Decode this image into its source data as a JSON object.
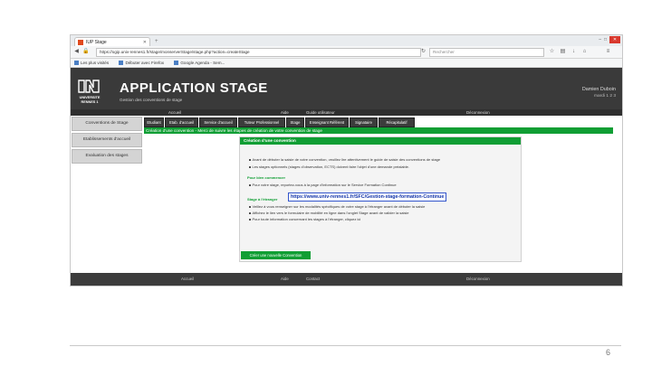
{
  "browser": {
    "tab_title": "IUP Stage",
    "new_tab": "+",
    "url": "https://ogip.univ-rennes1.fr/stage/monserverStage/stage.php?action=createStage",
    "search_placeholder": "Rechercher",
    "bookmarks": [
      "Les plus visités",
      "Débuter avec Firefox",
      "Google Agenda - Sem..."
    ]
  },
  "app": {
    "title": "APPLICATION STAGE",
    "subtitle": "Gestion des conventions de stage",
    "logo_text": "UNIVERSITE RENNES 1",
    "user_name": "Damien Duboin",
    "user_date": "mardi 1 2 3",
    "menu": [
      "Accueil",
      "Aide",
      "Guide utilisateur",
      "Déconnexion"
    ]
  },
  "sidebar": {
    "items": [
      "Conventions de Stage",
      "Etablissements d'accueil",
      "Evaluation des stages"
    ]
  },
  "tabs": [
    "Etudiant",
    "Etab. d'accueil",
    "Service d'accueil",
    "Tuteur Professionnel",
    "Stage",
    "Enseignant Référent",
    "Signataire",
    "Récapitulatif"
  ],
  "green_bar": "Création d'une convention - Merci de suivre les étapes de création de votre convention de stage",
  "panel": {
    "title": "Création d'une convention",
    "lines": [
      "Avant de débuter la saisie de votre convention, veuillez lire attentivement le guide de saisie des conventions de stage",
      "Les stages optionnels (stages d'observation, ECTS) doivent faire l'objet d'une demande préalable."
    ],
    "section1": "Pour bien commencer",
    "section1_lines": [
      "Pour votre stage, reportez-vous à la page d'information sur le Service Formation Continue"
    ],
    "link": "https://www.univ-rennes1.fr/SFC/Gestion-stage-formation-Continue",
    "section2": "Stage à l'étranger",
    "section2_lines": [
      "Veillez à vous renseigner sur les modalités spécifiques de votre stage à l'étranger avant de débuter la saisie",
      "Affichez le lien vers le formulaire de mobilité en ligne dans l'onglet Stage avant de valider la saisie",
      "Pour toute information concernant les stages à l'étranger, cliquez ici"
    ],
    "create_button": "Créer une nouvelle Convention"
  },
  "footer": {
    "items": [
      "Accueil",
      "Aide",
      "Contact",
      "Déconnexion"
    ]
  },
  "slide": {
    "page_number": "6"
  },
  "colors": {
    "green": "#109e34",
    "header": "#3a3a3a",
    "link": "#1133aa"
  }
}
